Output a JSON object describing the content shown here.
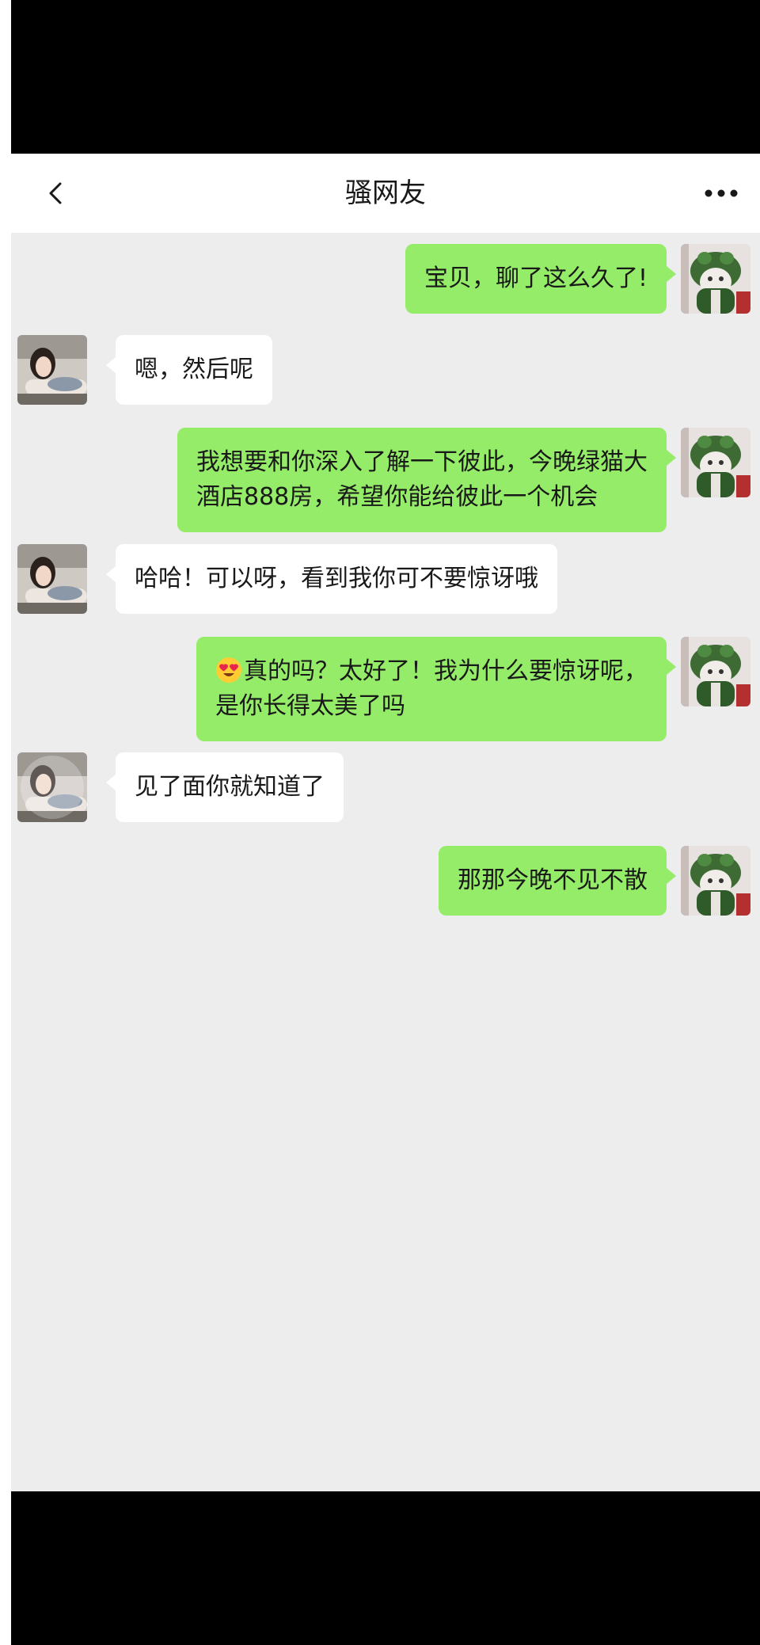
{
  "chat": {
    "title": "骚网友"
  },
  "icons": {
    "back": "chevron-left-icon",
    "more": "more-dots-icon",
    "heart_eyes": "heart-eyes-emoji"
  },
  "colors": {
    "outgoing_bubble": "#95ec69",
    "incoming_bubble": "#ffffff",
    "background": "#ededed"
  },
  "messages": [
    {
      "from": "me",
      "lines": [
        "宝贝，聊了这么久了!"
      ]
    },
    {
      "from": "friend",
      "lines": [
        "嗯，然后呢"
      ]
    },
    {
      "from": "me",
      "lines": [
        "我想要和你深入了解一下彼此，今晚绿猫大",
        "酒店888房，希望你能给彼此一个机会"
      ]
    },
    {
      "from": "friend",
      "lines": [
        "哈哈！可以呀，看到我你可不要惊讶哦"
      ]
    },
    {
      "from": "me",
      "lines": [
        "真的吗？太好了！我为什么要惊讶呢，",
        "是你长得太美了吗"
      ],
      "emoji": "heart-eyes-emoji"
    },
    {
      "from": "friend",
      "lines": [
        "见了面你就知道了"
      ]
    },
    {
      "from": "me",
      "lines": [
        "那那今晚不见不散"
      ]
    }
  ]
}
